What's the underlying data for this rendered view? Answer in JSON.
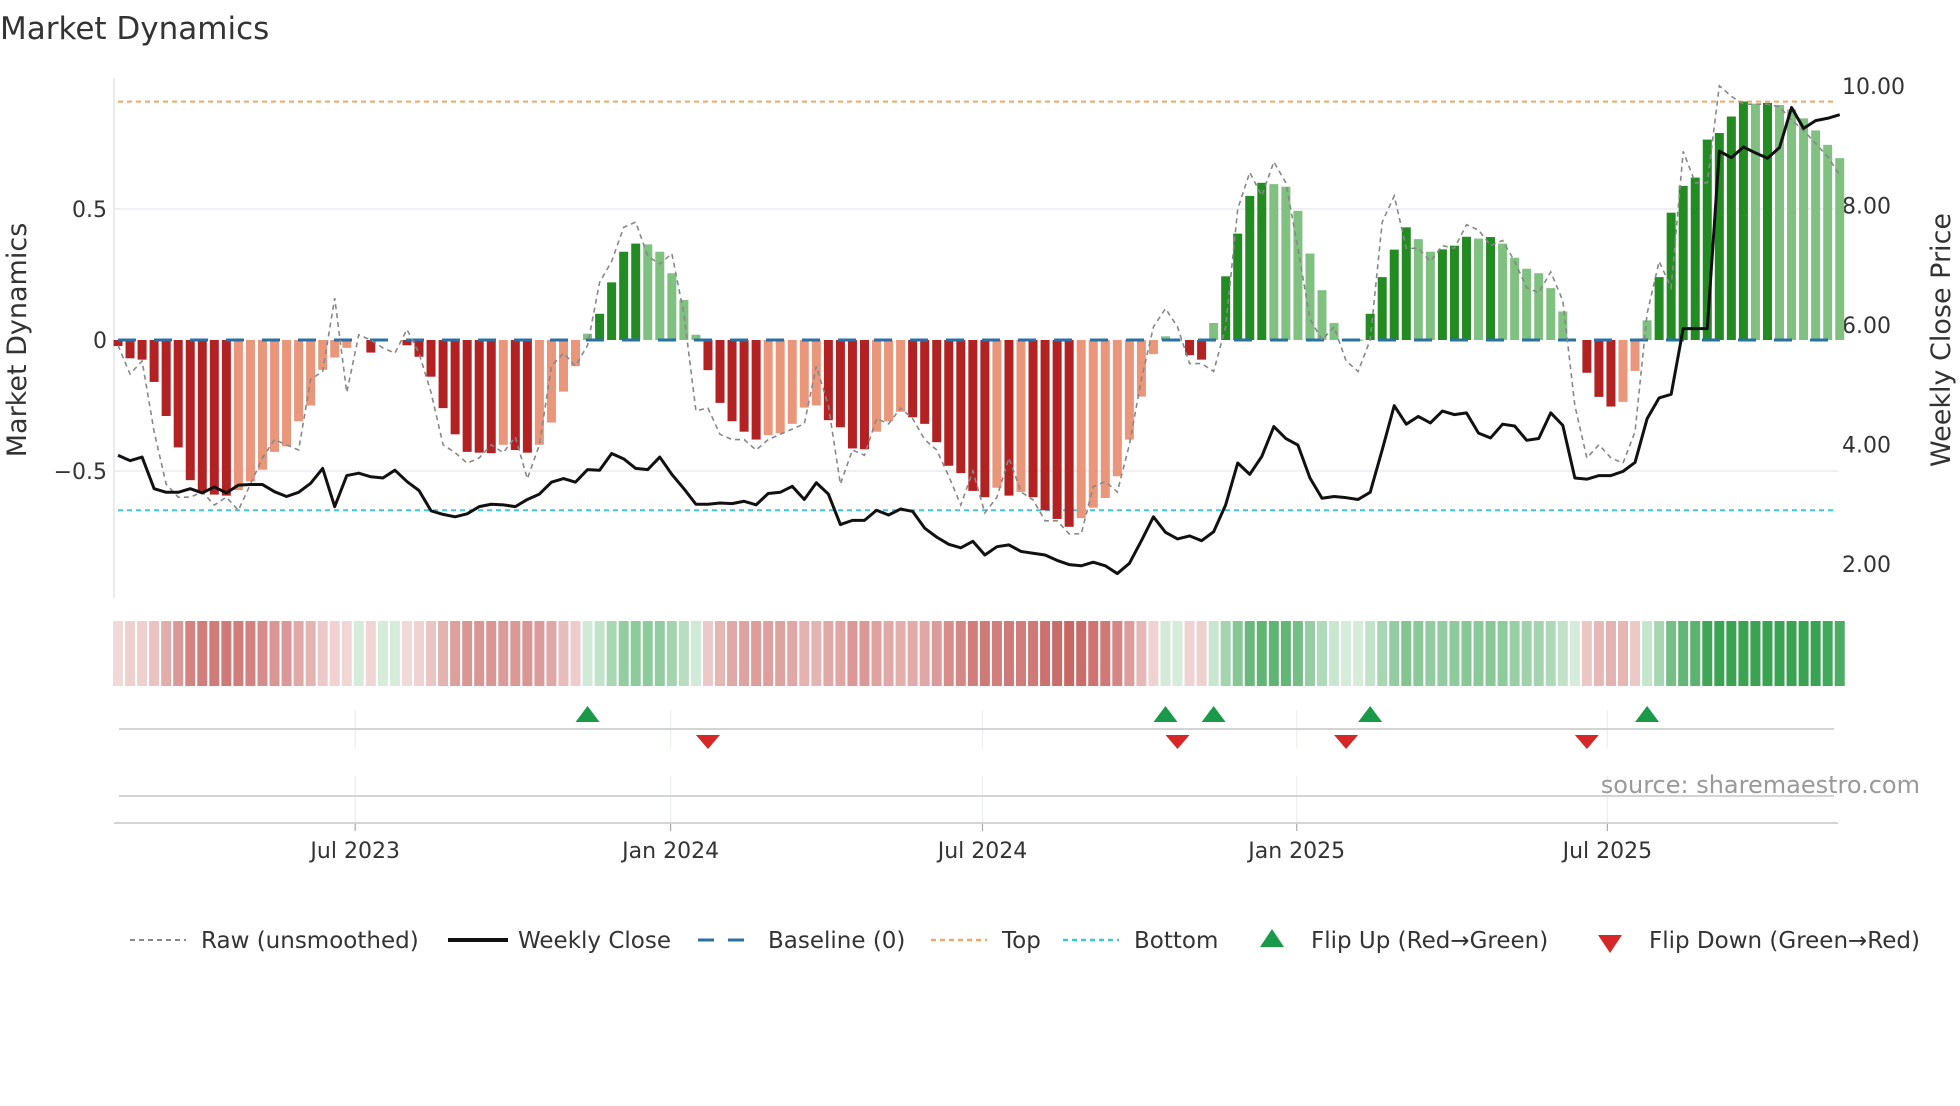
{
  "chart_data": {
    "type": "bar",
    "title": "Market Dynamics",
    "ylabel": "Market Dynamics",
    "ylabel_right": "Weekly Close Price",
    "ylim": [
      -1.0,
      1.0
    ],
    "ylim_right": [
      1.3,
      10.3
    ],
    "yticks": [
      "0.5",
      "0",
      "−0.5"
    ],
    "ytick_values": [
      0.5,
      0,
      -0.5
    ],
    "yticks_right": [
      "10.00",
      "8.00",
      "6.00",
      "4.00",
      "2.00"
    ],
    "ytick_right_values": [
      10,
      8,
      6,
      4,
      2
    ],
    "xticks": [
      "Jul 2023",
      "Jan 2024",
      "Jul 2024",
      "Jan 2025",
      "Jul 2025"
    ],
    "xtick_week_index": [
      19.7,
      45.9,
      71.8,
      97.9,
      123.7
    ],
    "x_unit": "weeks",
    "grid": true,
    "legend_position": "bottom",
    "top_level": 0.91,
    "bottom_level": -0.65,
    "baseline": 0,
    "bars": [
      -0.023,
      -0.07,
      -0.075,
      -0.16,
      -0.29,
      -0.41,
      -0.535,
      -0.576,
      -0.59,
      -0.594,
      -0.573,
      -0.54,
      -0.495,
      -0.427,
      -0.406,
      -0.31,
      -0.25,
      -0.114,
      -0.067,
      -0.03,
      0,
      -0.048,
      0,
      0,
      -0.02,
      -0.064,
      -0.14,
      -0.26,
      -0.36,
      -0.427,
      -0.43,
      -0.432,
      -0.4,
      -0.42,
      -0.43,
      -0.4,
      -0.315,
      -0.197,
      -0.1,
      0.024,
      0.1,
      0.22,
      0.337,
      0.368,
      0.365,
      0.337,
      0.255,
      0.153,
      0.02,
      -0.115,
      -0.24,
      -0.31,
      -0.35,
      -0.38,
      -0.363,
      -0.356,
      -0.32,
      -0.258,
      -0.25,
      -0.306,
      -0.333,
      -0.414,
      -0.417,
      -0.35,
      -0.31,
      -0.274,
      -0.295,
      -0.32,
      -0.39,
      -0.48,
      -0.508,
      -0.576,
      -0.6,
      -0.564,
      -0.594,
      -0.58,
      -0.6,
      -0.65,
      -0.683,
      -0.713,
      -0.68,
      -0.64,
      -0.603,
      -0.52,
      -0.38,
      -0.216,
      -0.054,
      0.014,
      0.002,
      -0.058,
      -0.075,
      0.065,
      0.243,
      0.406,
      0.55,
      0.6,
      0.595,
      0.585,
      0.493,
      0.33,
      0.19,
      0.065,
      0.003,
      0.002,
      0.1,
      0.24,
      0.345,
      0.43,
      0.385,
      0.337,
      0.346,
      0.36,
      0.394,
      0.387,
      0.393,
      0.368,
      0.314,
      0.272,
      0.255,
      0.198,
      0.109,
      0,
      -0.125,
      -0.217,
      -0.254,
      -0.236,
      -0.118,
      0.075,
      0.24,
      0.486,
      0.588,
      0.62,
      0.765,
      0.79,
      0.853,
      0.91,
      0.902,
      0.905,
      0.897,
      0.88,
      0.846,
      0.8,
      0.745,
      0.694
    ],
    "raw": [
      -0.02,
      -0.13,
      -0.08,
      -0.35,
      -0.55,
      -0.6,
      -0.6,
      -0.58,
      -0.63,
      -0.6,
      -0.65,
      -0.55,
      -0.45,
      -0.38,
      -0.4,
      -0.42,
      -0.15,
      -0.12,
      0.16,
      -0.2,
      0.02,
      0.0,
      -0.03,
      -0.05,
      0.04,
      -0.05,
      -0.2,
      -0.4,
      -0.43,
      -0.47,
      -0.45,
      -0.4,
      -0.43,
      -0.37,
      -0.53,
      -0.4,
      -0.1,
      -0.05,
      -0.1,
      -0.02,
      0.22,
      0.3,
      0.43,
      0.45,
      0.32,
      0.29,
      0.33,
      0.1,
      -0.27,
      -0.26,
      -0.36,
      -0.38,
      -0.38,
      -0.42,
      -0.38,
      -0.36,
      -0.34,
      -0.32,
      -0.1,
      -0.25,
      -0.55,
      -0.42,
      -0.44,
      -0.3,
      -0.32,
      -0.26,
      -0.3,
      -0.38,
      -0.42,
      -0.52,
      -0.63,
      -0.5,
      -0.66,
      -0.6,
      -0.45,
      -0.58,
      -0.61,
      -0.69,
      -0.69,
      -0.74,
      -0.74,
      -0.56,
      -0.54,
      -0.58,
      -0.4,
      -0.15,
      0.05,
      0.12,
      0.05,
      -0.09,
      -0.09,
      -0.12,
      0.05,
      0.5,
      0.64,
      0.55,
      0.68,
      0.6,
      0.35,
      0.08,
      0.0,
      0.05,
      -0.08,
      -0.12,
      0.0,
      0.45,
      0.55,
      0.35,
      0.35,
      0.3,
      0.36,
      0.35,
      0.44,
      0.42,
      0.36,
      0.38,
      0.3,
      0.2,
      0.18,
      0.26,
      0.15,
      -0.25,
      -0.45,
      -0.4,
      -0.45,
      -0.47,
      -0.35,
      0.1,
      0.3,
      0.2,
      0.72,
      0.6,
      0.6,
      0.97,
      0.93,
      0.9,
      0.9,
      0.9,
      0.89,
      0.84,
      0.8,
      0.75,
      0.7,
      0.63
    ],
    "weekly_close": [
      3.82,
      3.73,
      3.79,
      3.26,
      3.2,
      3.2,
      3.26,
      3.19,
      3.29,
      3.19,
      3.32,
      3.33,
      3.33,
      3.21,
      3.13,
      3.2,
      3.35,
      3.6,
      2.96,
      3.48,
      3.52,
      3.46,
      3.44,
      3.57,
      3.38,
      3.23,
      2.89,
      2.83,
      2.79,
      2.84,
      2.96,
      3.0,
      2.99,
      2.96,
      3.08,
      3.17,
      3.37,
      3.43,
      3.37,
      3.58,
      3.57,
      3.85,
      3.76,
      3.6,
      3.58,
      3.79,
      3.5,
      3.26,
      3.0,
      3.0,
      3.02,
      3.01,
      3.05,
      2.99,
      3.18,
      3.2,
      3.3,
      3.08,
      3.36,
      3.17,
      2.66,
      2.73,
      2.73,
      2.9,
      2.82,
      2.92,
      2.88,
      2.6,
      2.45,
      2.33,
      2.27,
      2.38,
      2.15,
      2.29,
      2.32,
      2.21,
      2.18,
      2.15,
      2.06,
      1.99,
      1.97,
      2.03,
      1.97,
      1.84,
      2.01,
      2.39,
      2.79,
      2.53,
      2.42,
      2.47,
      2.39,
      2.54,
      2.99,
      3.69,
      3.5,
      3.8,
      4.3,
      4.1,
      3.99,
      3.44,
      3.1,
      3.13,
      3.11,
      3.08,
      3.2,
      3.91,
      4.65,
      4.34,
      4.47,
      4.36,
      4.56,
      4.5,
      4.53,
      4.19,
      4.11,
      4.34,
      4.31,
      4.07,
      4.1,
      4.53,
      4.32,
      3.44,
      3.42,
      3.48,
      3.48,
      3.55,
      3.7,
      4.43,
      4.78,
      4.84,
      5.94,
      5.94,
      5.94,
      8.91,
      8.8,
      8.98,
      8.88,
      8.79,
      8.97,
      9.64,
      9.29,
      9.42,
      9.46,
      9.52
    ],
    "flip_up_weeks": [
      39,
      87,
      91,
      104,
      127
    ],
    "flip_down_weeks": [
      49,
      88,
      102,
      122
    ],
    "legend": [
      "Raw (unsmoothed)",
      "Weekly Close",
      "Baseline (0)",
      "Top",
      "Bottom",
      "Flip Up (Red→Green)",
      "Flip Down (Green→Red)"
    ],
    "source": "source: sharemaestro.com",
    "colors": {
      "bar_neg_strong": "#b22222",
      "bar_neg_weak": "#e9967a",
      "bar_pos_strong": "#228b22",
      "bar_pos_weak": "#80c080",
      "strip_red": "#c0504d",
      "strip_green": "#2e9e48",
      "raw": "#888888",
      "close": "#111111",
      "baseline": "#2a6fa5",
      "top": "#f0a868",
      "bottom": "#3cc8dc",
      "flip_up": "#1a9a48",
      "flip_down": "#d62728"
    }
  }
}
